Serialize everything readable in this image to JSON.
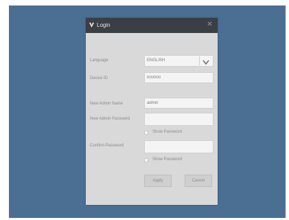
{
  "dialog": {
    "title": "Login",
    "icon": "user-icon",
    "close_icon": "close-icon"
  },
  "form": {
    "language_label": "Language",
    "language_value": "ENGLISH",
    "device_id_label": "Device ID",
    "device_id_value": "000000",
    "admin_name_label": "New Admin Name",
    "admin_name_value": "admin",
    "admin_password_label": "New Admin Password",
    "admin_password_value": "",
    "show_password_label_1": "Show Password",
    "confirm_password_label": "Confirm Password",
    "confirm_password_value": "",
    "show_password_label_2": "Show Password"
  },
  "buttons": {
    "apply": "Apply",
    "cancel": "Cancel"
  },
  "colors": {
    "desktop_bg": "#4b6f92",
    "dialog_bg": "#d9d9d9",
    "titlebar_bg": "#3a3f45"
  }
}
